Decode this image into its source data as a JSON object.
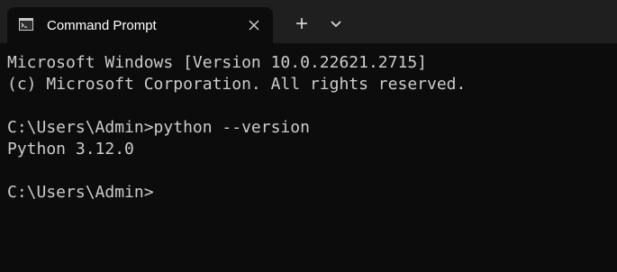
{
  "tab": {
    "title": "Command Prompt",
    "icon": "command-prompt-icon",
    "close_icon": "close-icon"
  },
  "toolbar": {
    "new_tab_icon": "plus-icon",
    "dropdown_icon": "chevron-down-icon"
  },
  "colors": {
    "titlebar_bg": "#1f1f1f",
    "terminal_bg": "#0c0c0c",
    "text": "#cccccc"
  },
  "console": {
    "lines": [
      "Microsoft Windows [Version 10.0.22621.2715]",
      "(c) Microsoft Corporation. All rights reserved.",
      "",
      "C:\\Users\\Admin>python --version",
      "Python 3.12.0",
      "",
      "C:\\Users\\Admin>"
    ]
  }
}
